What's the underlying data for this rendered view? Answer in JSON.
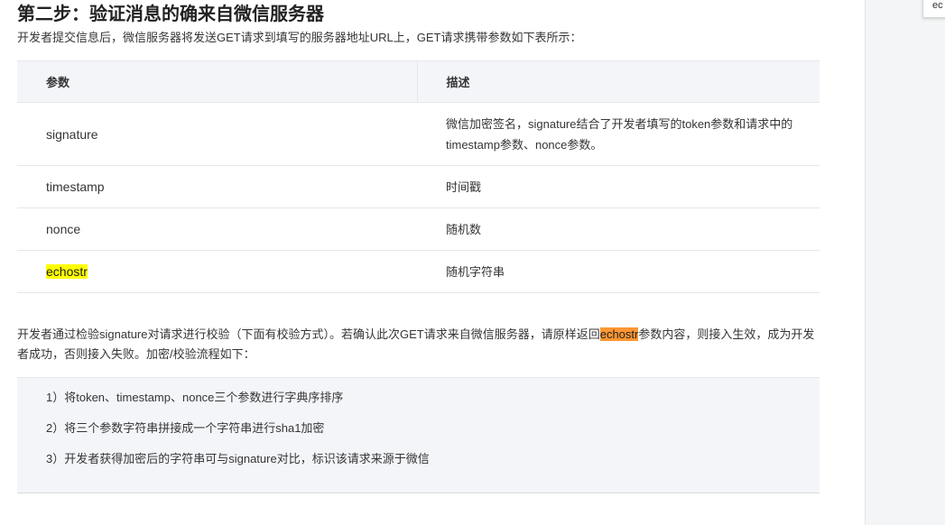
{
  "doc": {
    "title": "第二步：验证消息的确来自微信服务器",
    "intro": "开发者提交信息后，微信服务器将发送GET请求到填写的服务器地址URL上，GET请求携带参数如下表所示：",
    "table": {
      "headers": [
        "参数",
        "描述"
      ],
      "rows": [
        {
          "name": "signature",
          "desc": "微信加密签名，signature结合了开发者填写的token参数和请求中的timestamp参数、nonce参数。"
        },
        {
          "name": "timestamp",
          "desc": "时间戳"
        },
        {
          "name": "nonce",
          "desc": "随机数"
        },
        {
          "name": "echostr",
          "desc": "随机字符串"
        }
      ]
    },
    "paragraph": {
      "before": "开发者通过检验signature对请求进行校验（下面有校验方式）。若确认此次GET请求来自微信服务器，请原样返回",
      "highlight": "echostr",
      "after": "参数内容，则接入生效，成为开发者成功，否则接入失败。加密/校验流程如下："
    },
    "steps": [
      "1）将token、timestamp、nonce三个参数进行字典序排序",
      "2）将三个参数字符串拼接成一个字符串进行sha1加密",
      "3）开发者获得加密后的字符串可与signature对比，标识该请求来源于微信"
    ]
  },
  "find_bar": {
    "text": "ec"
  },
  "colors": {
    "highlight_match": "#ffff00",
    "highlight_active": "#ff9632",
    "table_header_bg": "#f4f5f9"
  }
}
